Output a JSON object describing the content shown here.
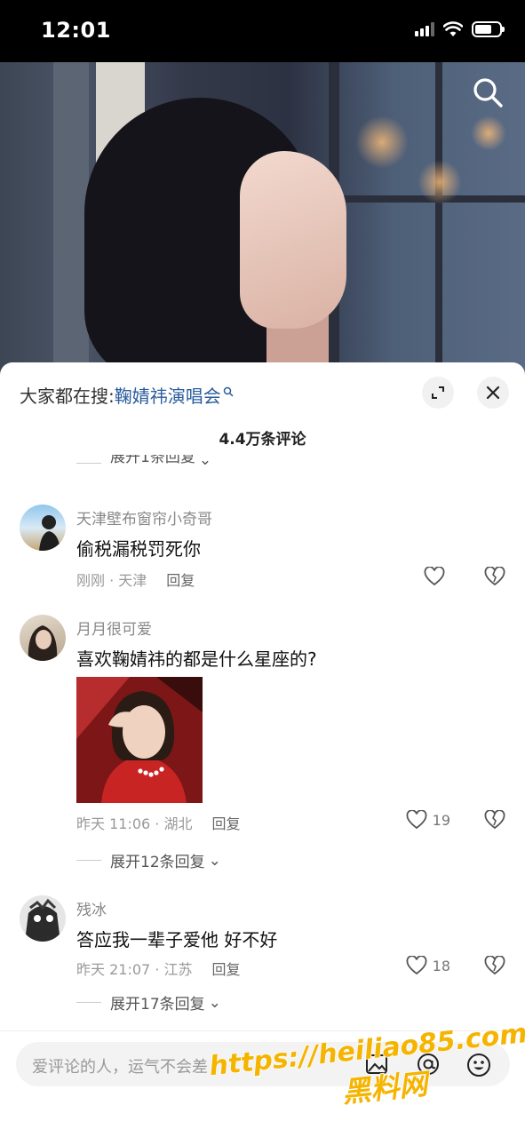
{
  "status_bar": {
    "time": "12:01"
  },
  "video": {
    "search_icon": "search-icon"
  },
  "sheet": {
    "trend_prefix": "大家都在搜:",
    "trend_link": "鞠婧祎演唱会",
    "comment_count": "4.4万条评论"
  },
  "comments": [
    {
      "partial_expand": "展开1条回复"
    },
    {
      "name": "天津壁布窗帘小奇哥",
      "text": "偷税漏税罚死你",
      "time_loc": "刚刚 · 天津",
      "reply": "回复",
      "likes": ""
    },
    {
      "name": "月月很可爱",
      "text": "喜欢鞠婧祎的都是什么星座的?",
      "time_loc": "昨天 11:06 · 湖北",
      "reply": "回复",
      "likes": "19",
      "expand": "展开12条回复"
    },
    {
      "name": "残冰",
      "text": "答应我一辈子爱他 好不好",
      "time_loc": "昨天 21:07 · 江苏",
      "reply": "回复",
      "likes": "18",
      "expand": "展开17条回复"
    }
  ],
  "input": {
    "placeholder": "爱评论的人，运气不会差"
  },
  "watermark": {
    "line1": "https://heiliao85.com",
    "line2": "黑料网"
  },
  "colors": {
    "link": "#2b5c9c",
    "watermark_fill": "#f5b400",
    "watermark_stroke": "#ffffff"
  }
}
